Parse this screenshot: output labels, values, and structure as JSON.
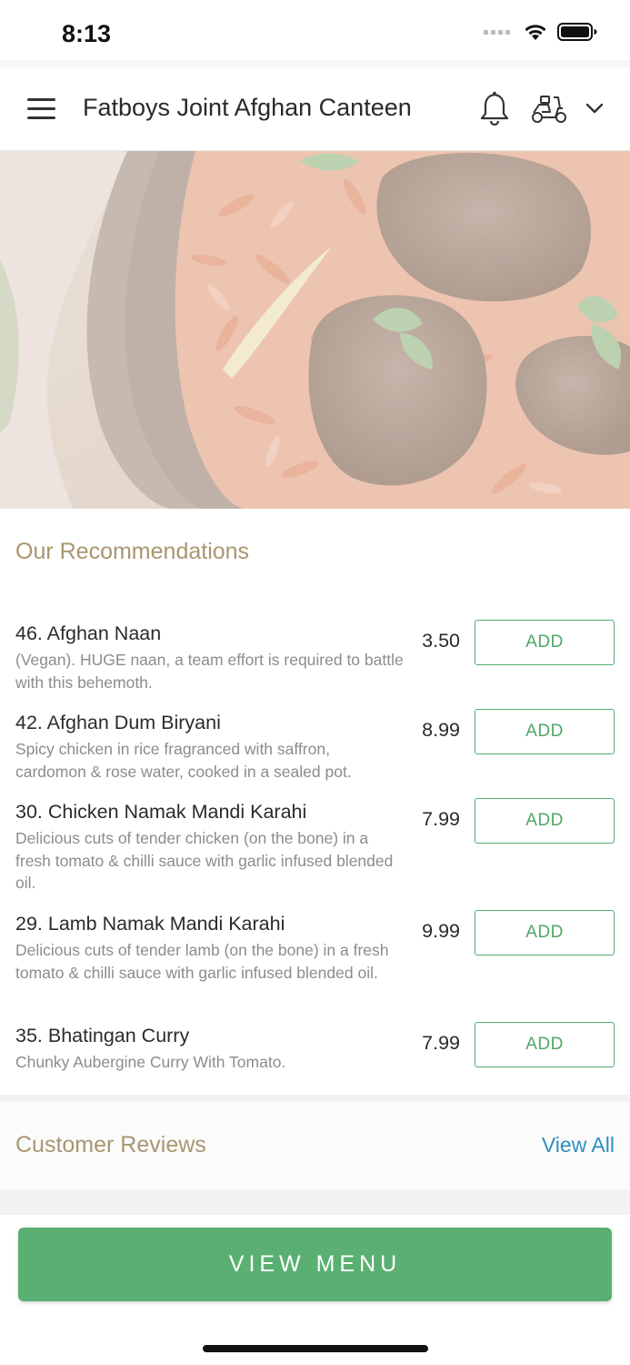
{
  "status_bar": {
    "time": "8:13"
  },
  "header": {
    "title": "Fatboys Joint Afghan Canteen",
    "icons": [
      "menu-icon",
      "bell-icon",
      "scooter-icon",
      "chevron-down-icon"
    ]
  },
  "hero": {
    "image": "biryani-with-lamb-photo"
  },
  "recommendations": {
    "title": "Our Recommendations",
    "add_label": "ADD",
    "items": [
      {
        "name": "46. Afghan Naan",
        "description": "(Vegan). HUGE naan, a team effort is required to battle with this behemoth.",
        "price": "3.50"
      },
      {
        "name": "42. Afghan Dum Biryani",
        "description": "Spicy chicken in rice fragranced with saffron, cardomon & rose water, cooked in a sealed pot.",
        "price": "8.99"
      },
      {
        "name": "30. Chicken Namak Mandi Karahi",
        "description": "Delicious cuts of tender chicken (on the bone) in a fresh tomato & chilli sauce with garlic infused blended oil.",
        "price": "7.99"
      },
      {
        "name": "29. Lamb Namak Mandi Karahi",
        "description": "Delicious cuts of tender lamb (on the bone) in a fresh tomato & chilli sauce with garlic infused blended oil.",
        "price": "9.99"
      },
      {
        "name": "35. Bhatingan Curry",
        "description": "Chunky Aubergine Curry With Tomato.",
        "price": "7.99"
      }
    ]
  },
  "reviews": {
    "title": "Customer Reviews",
    "view_all_label": "View All"
  },
  "footer": {
    "view_menu_label": "VIEW MENU"
  },
  "colors": {
    "accent_green": "#5aaf72",
    "section_title": "#a99670",
    "link_blue": "#2d8fc0"
  }
}
